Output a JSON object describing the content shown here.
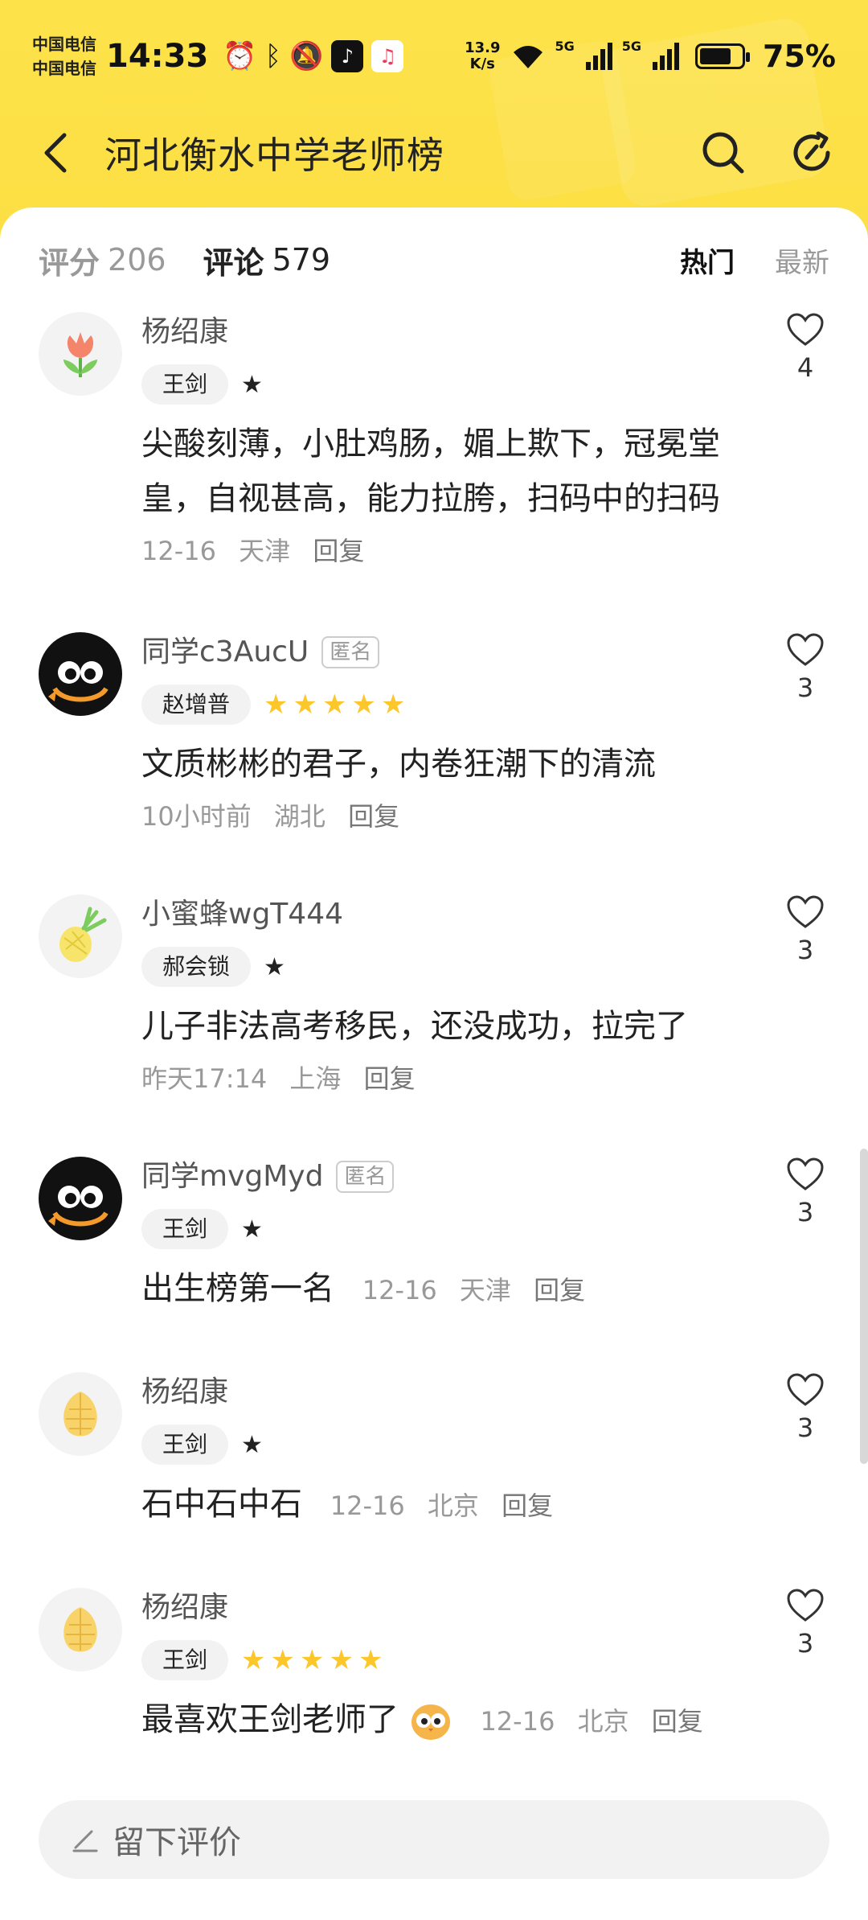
{
  "status_bar": {
    "carrier1": "中国电信",
    "carrier2": "中国电信",
    "time": "14:33",
    "speed_value": "13.9",
    "speed_unit": "K/s",
    "net1": "5G",
    "net2": "5G",
    "battery": "75%"
  },
  "header": {
    "title": "河北衡水中学老师榜"
  },
  "stats": {
    "rating_label": "评分",
    "rating_count": "206",
    "comment_label": "评论",
    "comment_count": "579",
    "sort_hot": "热门",
    "sort_new": "最新"
  },
  "comments": [
    {
      "user": "杨绍康",
      "teacher": "王剑",
      "rating": "half",
      "text": "尖酸刻薄，小肚鸡肠，媚上欺下，冠冕堂皇，自视甚高，能力拉胯，扫码中的扫码",
      "date": "12-16",
      "location": "天津",
      "reply": "回复",
      "likes": "4"
    },
    {
      "user": "同学c3AucU",
      "anon": "匿名",
      "teacher": "赵增普",
      "rating": "5",
      "text": "文质彬彬的君子，内卷狂潮下的清流",
      "date": "10小时前",
      "location": "湖北",
      "reply": "回复",
      "likes": "3"
    },
    {
      "user": "小蜜蜂wgT444",
      "teacher": "郝会锁",
      "rating": "half",
      "text": "儿子非法高考移民，还没成功，拉完了",
      "date": "昨天17:14",
      "location": "上海",
      "reply": "回复",
      "likes": "3"
    },
    {
      "user": "同学mvgMyd",
      "anon": "匿名",
      "teacher": "王剑",
      "rating": "half",
      "text": "出生榜第一名",
      "date": "12-16",
      "location": "天津",
      "reply": "回复",
      "likes": "3"
    },
    {
      "user": "杨绍康",
      "teacher": "王剑",
      "rating": "half",
      "text": "石中石中石",
      "date": "12-16",
      "location": "北京",
      "reply": "回复",
      "likes": "3"
    },
    {
      "user": "杨绍康",
      "teacher": "王剑",
      "rating": "5",
      "text": "最喜欢王剑老师了",
      "date": "12-16",
      "location": "北京",
      "reply": "回复",
      "likes": "3"
    }
  ],
  "bottom": {
    "placeholder": "留下评价"
  },
  "colors": {
    "brand_yellow": "#fde24a",
    "star": "#fcc72b"
  }
}
